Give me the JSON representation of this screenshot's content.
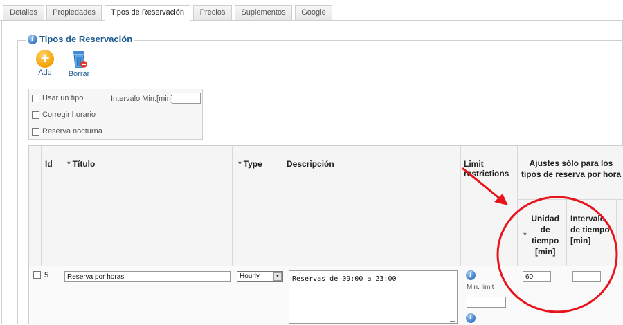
{
  "tabs": [
    {
      "label": "Detalles",
      "active": false
    },
    {
      "label": "Propiedades",
      "active": false
    },
    {
      "label": "Tipos de Reservación",
      "active": true
    },
    {
      "label": "Precios",
      "active": false
    },
    {
      "label": "Suplementos",
      "active": false
    },
    {
      "label": "Google",
      "active": false
    }
  ],
  "section": {
    "title": "Tipos de Reservación",
    "icon": "info-icon"
  },
  "toolbar": {
    "add_label": "Add",
    "delete_label": "Borrar"
  },
  "options": {
    "use_one_type": "Usar un tipo",
    "fix_schedule": "Corregir horario",
    "night_reservation": "Reserva nocturna",
    "interval_label": "Intervalo Min.[min]",
    "interval_value": ""
  },
  "table": {
    "headers": {
      "id": "Id",
      "title": "Título",
      "type": "Type",
      "description": "Descripción",
      "limit": "Limit restrictions",
      "hourly_settings": "Ajustes sólo para los tipos de reserva por hora",
      "time_unit": "Unidad de tiempo [min]",
      "time_interval": "Intervalo de tiempo [min]"
    },
    "required_marker": "*",
    "rows": [
      {
        "id": "5",
        "title": "Reserva por horas",
        "type": "Hourly",
        "description": "Reservas de 09:00 a 23:00",
        "min_limit_label": "Min. limit",
        "min_limit_value": "",
        "time_unit": "60",
        "time_interval": ""
      }
    ]
  },
  "colors": {
    "accent_blue": "#1f5a92",
    "annotation_red": "#e8141b",
    "border": "#cfcfcf"
  }
}
